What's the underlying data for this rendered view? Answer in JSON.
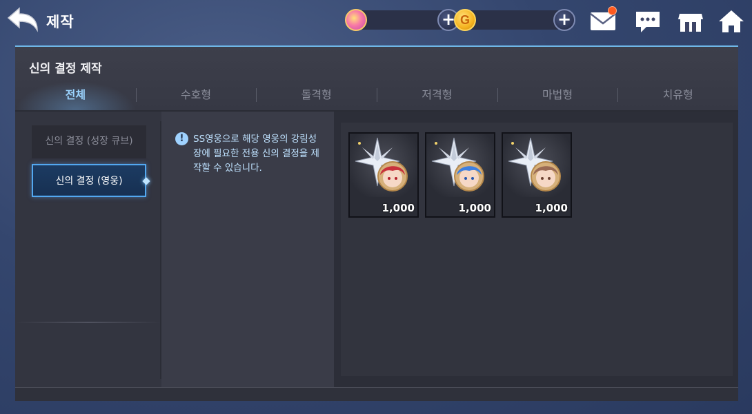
{
  "header": {
    "title": "제작",
    "back_icon": "back-arrow-icon"
  },
  "currencies": [
    {
      "name": "gem",
      "icon": "gem-icon",
      "value": ""
    },
    {
      "name": "gold",
      "icon": "gold-coin-icon",
      "glyph": "G",
      "value": ""
    }
  ],
  "plus_glyph": "+",
  "top_icons": [
    "mail-icon",
    "chat-icon",
    "shop-icon",
    "home-icon"
  ],
  "panel": {
    "section_title": "신의 결정 제작",
    "tabs": [
      {
        "label": "전체",
        "active": true
      },
      {
        "label": "수호형",
        "active": false
      },
      {
        "label": "돌격형",
        "active": false
      },
      {
        "label": "저격형",
        "active": false
      },
      {
        "label": "마법형",
        "active": false
      },
      {
        "label": "치유형",
        "active": false
      }
    ],
    "sub_buttons": [
      {
        "label": "신의 결정 (성장 큐브)",
        "active": false
      },
      {
        "label": "신의 결정 (영웅)",
        "active": true
      }
    ],
    "info": {
      "icon": "!",
      "text": "SS영웅으로 해당 영웅의 강림성장에 필요한 전용 신의 결정을 제작할 수 있습니다."
    },
    "items": [
      {
        "count": "1,000",
        "hair_color": "#c8323c"
      },
      {
        "count": "1,000",
        "hair_color": "#3d7fe0"
      },
      {
        "count": "1,000",
        "hair_color": "#9a6a55"
      }
    ]
  },
  "colors": {
    "accent": "#9bd4ff",
    "active_border": "#53a8f0",
    "notification": "#ff5a1f"
  }
}
